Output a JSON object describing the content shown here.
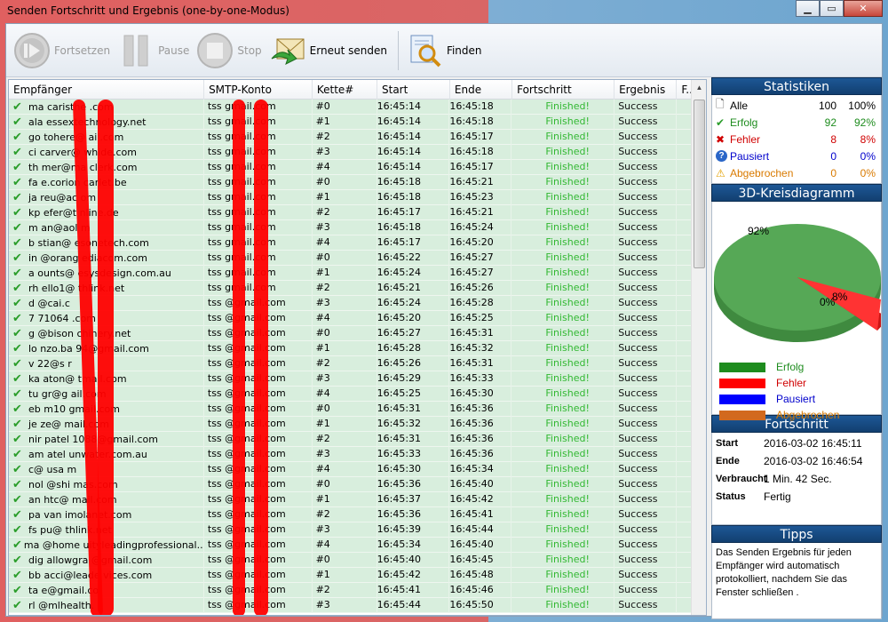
{
  "window": {
    "title": "Senden Fortschritt und Ergebnis (one-by-one-Modus)"
  },
  "toolbar": {
    "resume_label": "Fortsetzen",
    "pause_label": "Pause",
    "stop_label": "Stop",
    "resend_label": "Erneut senden",
    "find_label": "Finden"
  },
  "table": {
    "headers": [
      "Empfänger",
      "SMTP-Konto",
      "Kette#",
      "Start",
      "Ende",
      "Fortschritt",
      "Ergebnis",
      "F.."
    ],
    "rows": [
      {
        "emp": "ma    caristhe    .com",
        "smtp": "tss        gmail.com",
        "ket": "#0",
        "start": "16:45:14",
        "ende": "16:45:18",
        "fort": "Finished!",
        "erg": "Success"
      },
      {
        "emp": "ala    essextechnology.net",
        "smtp": "tss        gmail.com",
        "ket": "#1",
        "start": "16:45:14",
        "ende": "16:45:18",
        "fort": "Finished!",
        "erg": "Success"
      },
      {
        "emp": "go    tohere@    ail.com",
        "smtp": "tss        gmail.com",
        "ket": "#2",
        "start": "16:45:14",
        "ende": "16:45:17",
        "fort": "Finished!",
        "erg": "Success"
      },
      {
        "emp": "ci    carver@    whide.com",
        "smtp": "tss        gmail.com",
        "ket": "#3",
        "start": "16:45:14",
        "ende": "16:45:18",
        "fort": "Finished!",
        "erg": "Success"
      },
      {
        "emp": "th    mer@ma    clerk.com",
        "smtp": "tss        gmail.com",
        "ket": "#4",
        "start": "16:45:14",
        "ende": "16:45:17",
        "fort": "Finished!",
        "erg": "Success"
      },
      {
        "emp": "fa    e.corion    carlet.be",
        "smtp": "tss        gmail.com",
        "ket": "#0",
        "start": "16:45:18",
        "ende": "16:45:21",
        "fort": "Finished!",
        "erg": "Success"
      },
      {
        "emp": "ja    reu@ac    om",
        "smtp": "tss        gmail.com",
        "ket": "#1",
        "start": "16:45:18",
        "ende": "16:45:23",
        "fort": "Finished!",
        "erg": "Success"
      },
      {
        "emp": "kp    efer@t    nline.de",
        "smtp": "tss        gmail.com",
        "ket": "#2",
        "start": "16:45:17",
        "ende": "16:45:21",
        "fort": "Finished!",
        "erg": "Success"
      },
      {
        "emp": "m    an@aol    m",
        "smtp": "tss        gmail.com",
        "ket": "#3",
        "start": "16:45:18",
        "ende": "16:45:24",
        "fort": "Finished!",
        "erg": "Success"
      },
      {
        "emp": "b    stian@    esonetech.com",
        "smtp": "tss        gmail.com",
        "ket": "#4",
        "start": "16:45:17",
        "ende": "16:45:20",
        "fort": "Finished!",
        "erg": "Success"
      },
      {
        "emp": "in    @orang    ediacom.com",
        "smtp": "tss        gmail.com",
        "ket": "#0",
        "start": "16:45:22",
        "ende": "16:45:27",
        "fort": "Finished!",
        "erg": "Success"
      },
      {
        "emp": "a    ounts@    esysdesign.com.au",
        "smtp": "tss        gmail.com",
        "ket": "#1",
        "start": "16:45:24",
        "ende": "16:45:27",
        "fort": "Finished!",
        "erg": "Success"
      },
      {
        "emp": "rh    ello1@    thlink.net",
        "smtp": "tss        gmail.com",
        "ket": "#2",
        "start": "16:45:21",
        "ende": "16:45:26",
        "fort": "Finished!",
        "erg": "Success"
      },
      {
        "emp": "d    @cai.c",
        "smtp": "tss        @gmail.com",
        "ket": "#3",
        "start": "16:45:24",
        "ende": "16:45:28",
        "fort": "Finished!",
        "erg": "Success"
      },
      {
        "emp": "7    71064    .com",
        "smtp": "tss        @gmail.com",
        "ket": "#4",
        "start": "16:45:20",
        "ende": "16:45:25",
        "fort": "Finished!",
        "erg": "Success"
      },
      {
        "emp": "g    @bison    chinery.net",
        "smtp": "tss        @gmail.com",
        "ket": "#0",
        "start": "16:45:27",
        "ende": "16:45:31",
        "fort": "Finished!",
        "erg": "Success"
      },
      {
        "emp": "lo    nzo.ba    94@gmail.com",
        "smtp": "tss        @gmail.com",
        "ket": "#1",
        "start": "16:45:28",
        "ende": "16:45:32",
        "fort": "Finished!",
        "erg": "Success"
      },
      {
        "emp": "v    22@s    r",
        "smtp": "tss        @gmail.com",
        "ket": "#2",
        "start": "16:45:26",
        "ende": "16:45:31",
        "fort": "Finished!",
        "erg": "Success"
      },
      {
        "emp": "ka    aton@    tmail.com",
        "smtp": "tss        @gmail.com",
        "ket": "#3",
        "start": "16:45:29",
        "ende": "16:45:33",
        "fort": "Finished!",
        "erg": "Success"
      },
      {
        "emp": "tu    gr@g    ail.com",
        "smtp": "tss        @gmail.com",
        "ket": "#4",
        "start": "16:45:25",
        "ende": "16:45:30",
        "fort": "Finished!",
        "erg": "Success"
      },
      {
        "emp": "eb    m10    gmail.com",
        "smtp": "tss        @gmail.com",
        "ket": "#0",
        "start": "16:45:31",
        "ende": "16:45:36",
        "fort": "Finished!",
        "erg": "Success"
      },
      {
        "emp": "je    ze@    mail.com",
        "smtp": "tss        @gmail.com",
        "ket": "#1",
        "start": "16:45:32",
        "ende": "16:45:36",
        "fort": "Finished!",
        "erg": "Success"
      },
      {
        "emp": "nir    patel    1088@gmail.com",
        "smtp": "tss        @gmail.com",
        "ket": "#2",
        "start": "16:45:31",
        "ende": "16:45:36",
        "fort": "Finished!",
        "erg": "Success"
      },
      {
        "emp": "am    atel    unwater.com.au",
        "smtp": "tss        @gmail.com",
        "ket": "#3",
        "start": "16:45:33",
        "ende": "16:45:36",
        "fort": "Finished!",
        "erg": "Success"
      },
      {
        "emp": "c@    usa    m",
        "smtp": "tss        @gmail.com",
        "ket": "#4",
        "start": "16:45:30",
        "ende": "16:45:34",
        "fort": "Finished!",
        "erg": "Success"
      },
      {
        "emp": "nol    @shi    mas.com",
        "smtp": "tss        @gmail.com",
        "ket": "#0",
        "start": "16:45:36",
        "ende": "16:45:40",
        "fort": "Finished!",
        "erg": "Success"
      },
      {
        "emp": "an    htc@    mail.com",
        "smtp": "tss        @gmail.com",
        "ket": "#1",
        "start": "16:45:37",
        "ende": "16:45:42",
        "fort": "Finished!",
        "erg": "Success"
      },
      {
        "emp": "pa    van    imolanet.com",
        "smtp": "tss        @gmail.com",
        "ket": "#2",
        "start": "16:45:36",
        "ende": "16:45:41",
        "fort": "Finished!",
        "erg": "Success"
      },
      {
        "emp": "fs    pu@    thlink.net",
        "smtp": "tss        @gmail.com",
        "ket": "#3",
        "start": "16:45:39",
        "ende": "16:45:44",
        "fort": "Finished!",
        "erg": "Success"
      },
      {
        "emp": "ma    @home    uityleadingprofessional...",
        "smtp": "tss        @gmail.com",
        "ket": "#4",
        "start": "16:45:34",
        "ende": "16:45:40",
        "fort": "Finished!",
        "erg": "Success"
      },
      {
        "emp": "dig    allowgra    @gmail.com",
        "smtp": "tss        @gmail.com",
        "ket": "#0",
        "start": "16:45:40",
        "ende": "16:45:45",
        "fort": "Finished!",
        "erg": "Success"
      },
      {
        "emp": "bb    acci@leade    vices.com",
        "smtp": "tss        @gmail.com",
        "ket": "#1",
        "start": "16:45:42",
        "ende": "16:45:48",
        "fort": "Finished!",
        "erg": "Success"
      },
      {
        "emp": "ta    e@gmail.co",
        "smtp": "tss        @gmail.com",
        "ket": "#2",
        "start": "16:45:41",
        "ende": "16:45:46",
        "fort": "Finished!",
        "erg": "Success"
      },
      {
        "emp": "rl    @mlhealth.",
        "smtp": "tss        @gmail.com",
        "ket": "#3",
        "start": "16:45:44",
        "ende": "16:45:50",
        "fort": "Finished!",
        "erg": "Success"
      }
    ]
  },
  "stats": {
    "title": "Statistiken",
    "rows": [
      {
        "icon": "document-icon",
        "name": "Alle",
        "value": "100",
        "pct": "100%",
        "color": "#000000"
      },
      {
        "icon": "checkmark-icon",
        "name": "Erfolg",
        "value": "92",
        "pct": "92%",
        "color": "#1e8c1e"
      },
      {
        "icon": "cross-icon",
        "name": "Fehler",
        "value": "8",
        "pct": "8%",
        "color": "#d00000"
      },
      {
        "icon": "question-icon",
        "name": "Pausiert",
        "value": "0",
        "pct": "0%",
        "color": "#0000cc"
      },
      {
        "icon": "warning-icon",
        "name": "Abgebrochen",
        "value": "0",
        "pct": "0%",
        "color": "#d97a00"
      }
    ]
  },
  "pie": {
    "title": "3D-Kreisdiagramm",
    "slices": [
      {
        "label": "92%",
        "value": 92,
        "color": "#56a856"
      },
      {
        "label": "8%",
        "value": 8,
        "color": "#ff3030"
      },
      {
        "label": "0%",
        "value": 0,
        "color": "#2222ff"
      }
    ],
    "legend": [
      {
        "label": "Erfolg",
        "swatch": "#1e8c1e",
        "text_color": "#1e8c1e"
      },
      {
        "label": "Fehler",
        "swatch": "#ff0000",
        "text_color": "#d00000"
      },
      {
        "label": "Pausiert",
        "swatch": "#0000ff",
        "text_color": "#0000cc"
      },
      {
        "label": "Abgebrochen",
        "swatch": "#d2691e",
        "text_color": "#d97a00"
      }
    ]
  },
  "progress": {
    "title": "Fortschritt",
    "start_key": "Start",
    "start_val": "2016-03-02 16:45:11",
    "end_key": "Ende",
    "end_val": "2016-03-02 16:46:54",
    "used_key": "Verbraucht",
    "used_val": "1 Min. 42 Sec.",
    "status_key": "Status",
    "status_val": "Fertig"
  },
  "tips": {
    "title": "Tipps",
    "text": "Das Senden Ergebnis für jeden Empfänger wird automatisch protokolliert, nachdem Sie das Fenster schließen ."
  },
  "colors": {
    "row_bg": "#d8eedd",
    "accent_header": "#1d5795",
    "success_text": "#32b832",
    "redaction": "#ff0000"
  }
}
